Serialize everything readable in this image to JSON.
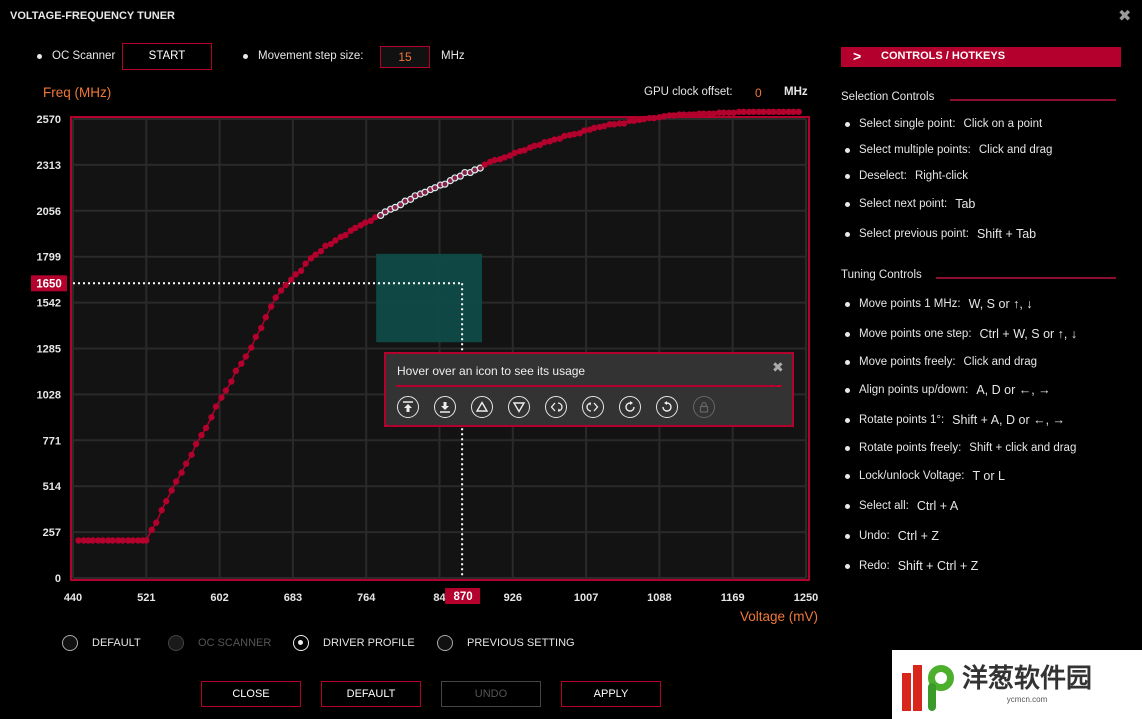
{
  "window": {
    "title": "VOLTAGE-FREQUENCY TUNER",
    "close_icon": "close-x-icon"
  },
  "toolbar": {
    "oc_scanner_label": "OC Scanner",
    "start_button": "START",
    "step_size_label": "Movement step size:",
    "step_size_value": "15",
    "step_size_unit": "MHz",
    "gpu_offset_label": "GPU clock offset:",
    "gpu_offset_value": "0",
    "gpu_offset_unit": "MHz"
  },
  "chart_data": {
    "type": "scatter",
    "title": "",
    "xlabel": "Voltage (mV)",
    "ylabel": "Freq (MHz)",
    "xlim": [
      440,
      1250
    ],
    "ylim": [
      0,
      2570
    ],
    "x_ticks": [
      "440",
      "521",
      "602",
      "683",
      "764",
      "84",
      "926",
      "1007",
      "1088",
      "1169",
      "1250"
    ],
    "x_tick_values": [
      440,
      521,
      602,
      683,
      764,
      845,
      926,
      1007,
      1088,
      1169,
      1250
    ],
    "y_ticks": [
      "2570",
      "2313",
      "2056",
      "1799",
      "1542",
      "1285",
      "1028",
      "771",
      "514",
      "257",
      "0"
    ],
    "y_tick_values": [
      2570,
      2313,
      2056,
      1799,
      1542,
      1285,
      1028,
      771,
      514,
      257,
      0
    ],
    "grid": true,
    "highlight": {
      "voltage": 870,
      "voltage_label": "870",
      "freq": 1650,
      "freq_label": "1650"
    },
    "selection": {
      "x_range": [
        775,
        892
      ],
      "y_range": [
        1320,
        1815
      ]
    },
    "series": [
      {
        "name": "V/F curve",
        "color": "#b3002d",
        "points": [
          [
            446,
            210
          ],
          [
            452,
            210
          ],
          [
            457,
            210
          ],
          [
            462,
            210
          ],
          [
            468,
            210
          ],
          [
            473,
            210
          ],
          [
            479,
            210
          ],
          [
            484,
            210
          ],
          [
            490,
            210
          ],
          [
            495,
            210
          ],
          [
            501,
            210
          ],
          [
            506,
            210
          ],
          [
            512,
            210
          ],
          [
            517,
            210
          ],
          [
            521,
            210
          ],
          [
            527,
            270
          ],
          [
            532,
            310
          ],
          [
            538,
            380
          ],
          [
            543,
            430
          ],
          [
            549,
            490
          ],
          [
            554,
            540
          ],
          [
            560,
            590
          ],
          [
            565,
            640
          ],
          [
            571,
            690
          ],
          [
            576,
            750
          ],
          [
            582,
            800
          ],
          [
            587,
            840
          ],
          [
            593,
            900
          ],
          [
            598,
            960
          ],
          [
            604,
            1010
          ],
          [
            609,
            1050
          ],
          [
            615,
            1100
          ],
          [
            620,
            1160
          ],
          [
            626,
            1200
          ],
          [
            631,
            1240
          ],
          [
            637,
            1290
          ],
          [
            642,
            1350
          ],
          [
            648,
            1400
          ],
          [
            653,
            1460
          ],
          [
            659,
            1520
          ],
          [
            664,
            1570
          ],
          [
            670,
            1610
          ],
          [
            675,
            1640
          ],
          [
            681,
            1670
          ],
          [
            686,
            1700
          ],
          [
            692,
            1720
          ],
          [
            697,
            1760
          ],
          [
            703,
            1790
          ],
          [
            708,
            1810
          ],
          [
            714,
            1830
          ],
          [
            719,
            1860
          ],
          [
            725,
            1870
          ],
          [
            730,
            1890
          ],
          [
            736,
            1910
          ],
          [
            741,
            1920
          ],
          [
            747,
            1945
          ],
          [
            752,
            1960
          ],
          [
            758,
            1975
          ],
          [
            763,
            1990
          ],
          [
            769,
            2000
          ],
          [
            774,
            2020
          ],
          [
            780,
            2030
          ],
          [
            785,
            2050
          ],
          [
            791,
            2065
          ],
          [
            796,
            2075
          ],
          [
            802,
            2090
          ],
          [
            807,
            2110
          ],
          [
            813,
            2120
          ],
          [
            818,
            2140
          ],
          [
            824,
            2150
          ],
          [
            829,
            2160
          ],
          [
            835,
            2175
          ],
          [
            840,
            2185
          ],
          [
            846,
            2200
          ],
          [
            851,
            2205
          ],
          [
            857,
            2225
          ],
          [
            862,
            2240
          ],
          [
            868,
            2250
          ],
          [
            873,
            2270
          ],
          [
            879,
            2270
          ],
          [
            884,
            2285
          ],
          [
            890,
            2295
          ],
          [
            895,
            2315
          ],
          [
            901,
            2330
          ],
          [
            906,
            2340
          ],
          [
            912,
            2345
          ],
          [
            917,
            2355
          ],
          [
            923,
            2365
          ],
          [
            928,
            2380
          ],
          [
            934,
            2390
          ],
          [
            939,
            2395
          ],
          [
            945,
            2410
          ],
          [
            950,
            2420
          ],
          [
            956,
            2425
          ],
          [
            961,
            2440
          ],
          [
            967,
            2445
          ],
          [
            972,
            2455
          ],
          [
            978,
            2460
          ],
          [
            983,
            2475
          ],
          [
            989,
            2480
          ],
          [
            994,
            2485
          ],
          [
            1000,
            2490
          ],
          [
            1005,
            2505
          ],
          [
            1011,
            2510
          ],
          [
            1016,
            2520
          ],
          [
            1022,
            2525
          ],
          [
            1027,
            2530
          ],
          [
            1033,
            2540
          ],
          [
            1038,
            2540
          ],
          [
            1044,
            2545
          ],
          [
            1049,
            2545
          ],
          [
            1055,
            2560
          ],
          [
            1060,
            2560
          ],
          [
            1066,
            2565
          ],
          [
            1071,
            2570
          ],
          [
            1077,
            2575
          ],
          [
            1082,
            2575
          ],
          [
            1088,
            2580
          ],
          [
            1093,
            2585
          ],
          [
            1099,
            2590
          ],
          [
            1104,
            2590
          ],
          [
            1110,
            2595
          ],
          [
            1115,
            2595
          ],
          [
            1121,
            2595
          ],
          [
            1126,
            2595
          ],
          [
            1132,
            2600
          ],
          [
            1137,
            2600
          ],
          [
            1143,
            2600
          ],
          [
            1148,
            2600
          ],
          [
            1154,
            2605
          ],
          [
            1159,
            2605
          ],
          [
            1165,
            2605
          ],
          [
            1170,
            2605
          ],
          [
            1176,
            2610
          ],
          [
            1181,
            2610
          ],
          [
            1187,
            2610
          ],
          [
            1192,
            2610
          ],
          [
            1198,
            2610
          ],
          [
            1203,
            2610
          ],
          [
            1209,
            2610
          ],
          [
            1214,
            2610
          ],
          [
            1220,
            2610
          ],
          [
            1225,
            2610
          ],
          [
            1231,
            2610
          ],
          [
            1236,
            2610
          ],
          [
            1242,
            2610
          ]
        ]
      }
    ]
  },
  "popup": {
    "title": "Hover over an icon to see its usage",
    "close_icon": "close-x-icon",
    "icons": [
      {
        "name": "align-top-icon",
        "enabled": true
      },
      {
        "name": "align-bottom-icon",
        "enabled": true
      },
      {
        "name": "move-up-icon",
        "enabled": true
      },
      {
        "name": "move-down-icon",
        "enabled": true
      },
      {
        "name": "rotate-left-1deg-icon",
        "enabled": true
      },
      {
        "name": "rotate-right-1deg-icon",
        "enabled": true
      },
      {
        "name": "rotate-clockwise-icon",
        "enabled": true
      },
      {
        "name": "rotate-counterclockwise-icon",
        "enabled": true
      },
      {
        "name": "lock-icon",
        "enabled": false
      }
    ]
  },
  "controls_panel": {
    "header": "CONTROLS / HOTKEYS",
    "selection_title": "Selection Controls",
    "selection_items": [
      {
        "label": "Select single point:",
        "key": "Click on a point"
      },
      {
        "label": "Select multiple points:",
        "key": "Click and drag"
      },
      {
        "label": "Deselect:",
        "key": "Right-click"
      },
      {
        "label": "Select next point:",
        "key": "Tab"
      },
      {
        "label": "Select previous point:",
        "key": "Shift + Tab"
      }
    ],
    "tuning_title": "Tuning Controls",
    "tuning_items": [
      {
        "label": "Move points 1 MHz:",
        "key": "W, S or ↑, ↓"
      },
      {
        "label": "Move points one step:",
        "key": "Ctrl + W, S or ↑, ↓"
      },
      {
        "label": "Move points freely:",
        "key": "Click and drag"
      },
      {
        "label": "Align points up/down:",
        "key": "A, D or ←, →"
      },
      {
        "label": "Rotate points 1°:",
        "key": "Shift + A, D or ←, →"
      },
      {
        "label": "Rotate points freely:",
        "key": "Shift + click and drag"
      },
      {
        "label": "Lock/unlock Voltage:",
        "key": "T or L"
      },
      {
        "label": "Select all:",
        "key": "Ctrl + A"
      },
      {
        "label": "Undo:",
        "key": "Ctrl + Z"
      },
      {
        "label": "Redo:",
        "key": "Shift + Ctrl + Z"
      }
    ]
  },
  "profiles": {
    "options": [
      {
        "label": "DEFAULT",
        "checked": false,
        "enabled": true
      },
      {
        "label": "OC SCANNER",
        "checked": false,
        "enabled": false
      },
      {
        "label": "DRIVER PROFILE",
        "checked": true,
        "enabled": true
      },
      {
        "label": "PREVIOUS SETTING",
        "checked": false,
        "enabled": true
      }
    ]
  },
  "footer": {
    "close_button": "CLOSE",
    "default_button": "DEFAULT",
    "undo_button": "UNDO",
    "apply_button": "APPLY"
  },
  "watermark": {
    "text": "洋葱软件园",
    "sub": "ycmcn.com"
  },
  "colors": {
    "accent": "#b3002d",
    "value_orange": "#f07838",
    "selection_fill": "#0f4a48",
    "plot_bg": "#131313"
  }
}
